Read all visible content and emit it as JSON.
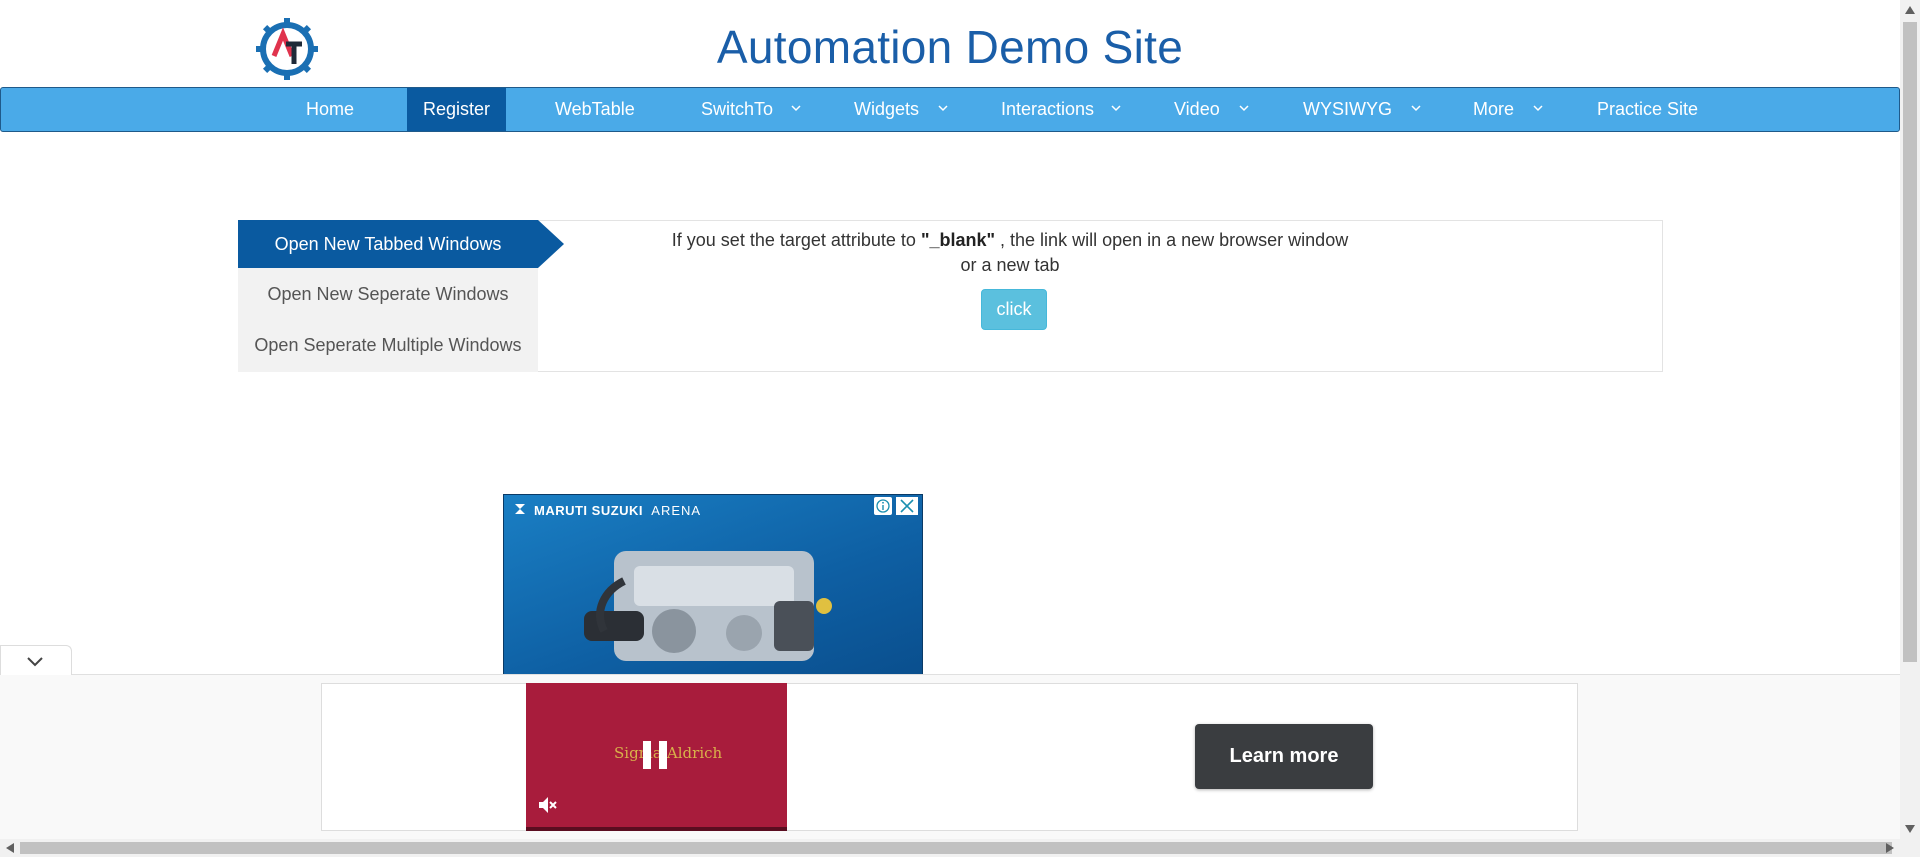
{
  "header": {
    "title": "Automation Demo Site",
    "logo_text": "AT"
  },
  "nav": {
    "items": [
      {
        "label": "Home",
        "dropdown": false,
        "active": false
      },
      {
        "label": "Register",
        "dropdown": false,
        "active": true
      },
      {
        "label": "WebTable",
        "dropdown": false,
        "active": false
      },
      {
        "label": "SwitchTo",
        "dropdown": true,
        "active": false
      },
      {
        "label": "Widgets",
        "dropdown": true,
        "active": false
      },
      {
        "label": "Interactions",
        "dropdown": true,
        "active": false
      },
      {
        "label": "Video",
        "dropdown": true,
        "active": false
      },
      {
        "label": "WYSIWYG",
        "dropdown": true,
        "active": false
      },
      {
        "label": "More",
        "dropdown": true,
        "active": false
      },
      {
        "label": "Practice Site",
        "dropdown": false,
        "active": false
      }
    ]
  },
  "tabs": {
    "items": [
      {
        "label": "Open New Tabbed Windows",
        "active": true
      },
      {
        "label": "Open New Seperate Windows",
        "active": false
      },
      {
        "label": "Open Seperate Multiple Windows",
        "active": false
      }
    ]
  },
  "content": {
    "desc_prefix": "If you set the target attribute to ",
    "desc_bold": "\"_blank\"",
    "desc_suffix": " , the link will open in a new browser window",
    "desc_line2": "or a new tab",
    "click_label": "click"
  },
  "ad": {
    "brand": "MARUTI SUZUKI",
    "brand_sub": "ARENA",
    "info_icon": "info-icon",
    "close_icon": "close-icon"
  },
  "bottom_ad": {
    "video_text": "Sigma-Aldrich",
    "learn_more_label": "Learn more"
  },
  "colors": {
    "title": "#1a5ea8",
    "navbar": "#4aaae8",
    "active": "#0a5aa0",
    "click_button": "#5bc0de"
  }
}
